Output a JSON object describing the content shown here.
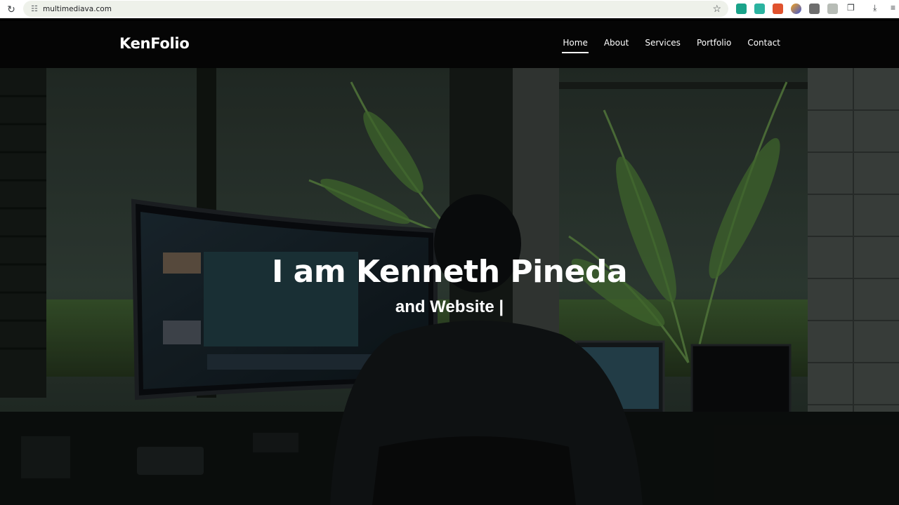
{
  "browser": {
    "url": "multimediava.com",
    "icons": [
      "reload-icon",
      "site-settings-icon",
      "bookmark-star-icon",
      "extension-icons",
      "extensions-puzzle-icon",
      "download-icon",
      "tab-search-icon"
    ]
  },
  "header": {
    "logo": "KenFolio",
    "nav": [
      {
        "label": "Home",
        "active": true
      },
      {
        "label": "About"
      },
      {
        "label": "Services"
      },
      {
        "label": "Portfolio"
      },
      {
        "label": "Contact"
      }
    ]
  },
  "hero": {
    "title": "I am Kenneth Pineda",
    "subtitle": "and Website |"
  },
  "colors": {
    "header_bg": "#050505",
    "text": "#ffffff",
    "chrome_bg": "#ffffff",
    "omnibox_bg": "#eef1ea"
  }
}
